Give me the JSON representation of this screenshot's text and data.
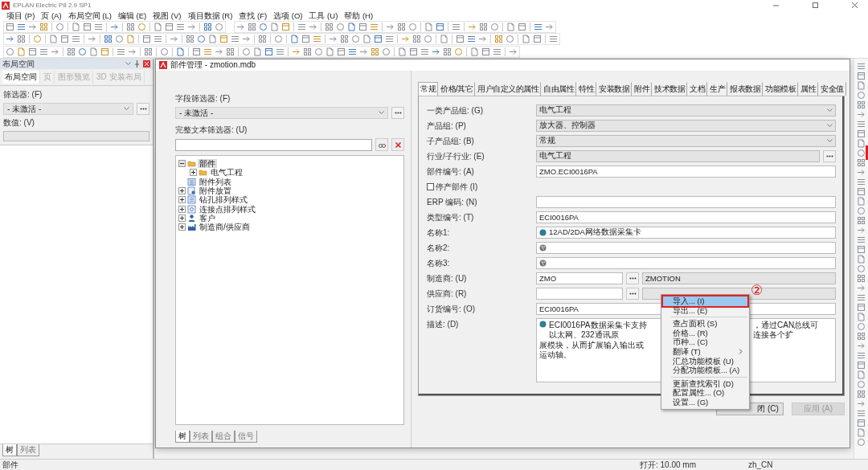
{
  "window": {
    "title": "EPLAN Electric P8 2.9 SP1"
  },
  "menu": [
    "项目 (P)",
    "页 (A)",
    "布局空间 (L)",
    "编辑 (E)",
    "视图 (V)",
    "项目数据 (R)",
    "查找 (F)",
    "选项 (O)",
    "工具 (U)",
    "帮助 (H)"
  ],
  "layout_panel": {
    "title": "布局空间",
    "tabs": [
      {
        "label": "布局空间",
        "selected": true
      },
      {
        "label": "页",
        "selected": false
      },
      {
        "label": "图形预览",
        "selected": false
      },
      {
        "label": "3D 安装布局",
        "selected": false
      }
    ],
    "filter": {
      "label": "筛选器: (F)",
      "value": "- 未激活 -"
    },
    "value_field": {
      "label": "数值: (V)"
    },
    "bottom_tabs": [
      {
        "label": "树",
        "selected": true
      },
      {
        "label": "列表",
        "selected": false
      }
    ]
  },
  "parts_dialog": {
    "title": "部件管理 - zmotion.mdb",
    "field_filter": {
      "label": "字段筛选器: (F)",
      "value": "- 未激活 -"
    },
    "text_filter": {
      "label": "完整文本筛选器: (U)"
    },
    "tree": [
      {
        "label": "部件",
        "kind": "folder",
        "expanded": true,
        "selected": true,
        "children": [
          {
            "label": "电气工程",
            "kind": "folder",
            "expanded": false,
            "selected": false
          }
        ]
      },
      {
        "label": "附件列表",
        "kind": "list",
        "selected": false
      },
      {
        "label": "附件放置",
        "kind": "placement",
        "expanded": false,
        "selected": false
      },
      {
        "label": "钻孔排列样式",
        "kind": "pattern",
        "expanded": false,
        "selected": false
      },
      {
        "label": "连接点排列样式",
        "kind": "connection",
        "expanded": false,
        "selected": false
      },
      {
        "label": "客户",
        "kind": "customer",
        "expanded": false,
        "selected": false
      },
      {
        "label": "制造商/供应商",
        "kind": "manufacturer",
        "expanded": false,
        "selected": false
      }
    ],
    "bottom_tabs": [
      {
        "label": "树",
        "selected": true
      },
      {
        "label": "列表",
        "selected": false
      },
      {
        "label": "组合",
        "selected": false
      },
      {
        "label": "信号",
        "selected": false
      }
    ],
    "tabs": [
      {
        "label": "常规",
        "selected": true
      },
      {
        "label": "价格/其它",
        "selected": false
      },
      {
        "label": "用户自定义的属性",
        "selected": false
      },
      {
        "label": "自由属性",
        "selected": false
      },
      {
        "label": "特性",
        "selected": false
      },
      {
        "label": "安装数据",
        "selected": false
      },
      {
        "label": "附件",
        "selected": false
      },
      {
        "label": "技术数据",
        "selected": false
      },
      {
        "label": "文档",
        "selected": false
      },
      {
        "label": "生产",
        "selected": false
      },
      {
        "label": "报表数据",
        "selected": false
      },
      {
        "label": "功能模板",
        "selected": false
      },
      {
        "label": "属性",
        "selected": false
      },
      {
        "label": "安全值",
        "selected": false
      }
    ],
    "form": [
      {
        "kind": "select",
        "label": "一类产品组: (G)",
        "value": "电气工程"
      },
      {
        "kind": "select",
        "label": "产品组: (P)",
        "value": "放大器、控制器"
      },
      {
        "kind": "select",
        "label": "子产品组: (B)",
        "value": "常规"
      },
      {
        "kind": "picker",
        "label": "行业/子行业: (E)",
        "value": "电气工程"
      },
      {
        "kind": "field",
        "label": "部件编号: (A)",
        "value": "ZMO.ECI0016PA"
      },
      {
        "kind": "checkbox",
        "label": "停产部件 (I)",
        "checked": false
      },
      {
        "kind": "field",
        "label": "ERP 编码: (N)"
      },
      {
        "kind": "field",
        "label": "类型编号: (T)",
        "value": "ECI0016PA"
      },
      {
        "kind": "lang",
        "label": "名称1:",
        "value": "12AD/2DA网络数据采集卡"
      },
      {
        "kind": "lang",
        "label": "名称2:"
      },
      {
        "kind": "lang",
        "label": "名称3:"
      },
      {
        "kind": "pair",
        "label": "制造商: (U)",
        "value": "ZMO",
        "name": "ZMOTION"
      },
      {
        "kind": "pair",
        "label": "供应商: (R)"
      },
      {
        "kind": "field",
        "label": "订货编号: (O)",
        "value": "ECI0016PA"
      },
      {
        "kind": "text",
        "label": "描述: (D)",
        "lines": [
          [
            "ECI0016PA数据采集卡支持以太网、232通讯原",
            "，通过CAN总线可连接各个扩"
          ],
          [
            "展模块，从而扩展输入输出或运动轴。"
          ]
        ]
      }
    ],
    "buttons": [
      {
        "label": "闭 (C)",
        "disabled": false
      },
      {
        "label": "应用 (A)",
        "disabled": true
      }
    ]
  },
  "context_menu": {
    "groups": [
      [
        {
          "label": "导入... (I)",
          "selected": true
        },
        {
          "label": "导出... (E)",
          "selected": false
        }
      ],
      [
        {
          "label": "查占面积 (S)",
          "selected": false
        },
        {
          "label": "价格... (R)",
          "selected": false
        },
        {
          "label": "币种... (C)",
          "selected": false
        },
        {
          "label": "翻译 (T)",
          "selected": false,
          "submenu": true
        },
        {
          "label": "汇总功能模板 (U)",
          "selected": false
        },
        {
          "label": "分配功能模板... (A)",
          "selected": false
        }
      ],
      [
        {
          "label": "更新查找索引 (D)",
          "selected": false
        },
        {
          "label": "配置属性... (O)",
          "selected": false
        },
        {
          "label": "设置... (G)",
          "selected": false
        }
      ]
    ]
  },
  "annotation": "②",
  "status_bar": {
    "left": "部件",
    "grid": "打开: 10.00 mm",
    "language": "zh_CN"
  }
}
